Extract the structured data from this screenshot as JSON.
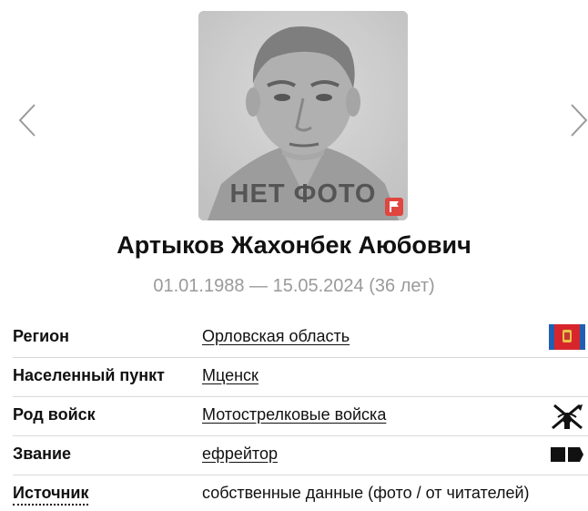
{
  "navigation": {
    "prev_icon": "chevron-left-icon",
    "next_icon": "chevron-right-icon"
  },
  "photo": {
    "caption": "НЕТ ФОТО",
    "report_icon": "flag-icon",
    "report_color": "#e0463f"
  },
  "person": {
    "name": "Артыков Жахонбек Аюбович",
    "dates": "01.01.1988 — 15.05.2024 (36 лет)"
  },
  "info": {
    "region": {
      "label": "Регион",
      "value": "Орловская область",
      "icon": "region-flag-icon"
    },
    "settlement": {
      "label": "Населенный пункт",
      "value": "Мценск"
    },
    "branch": {
      "label": "Род войск",
      "value": "Мотострелковые войска",
      "icon": "motor-rifle-emblem-icon"
    },
    "rank": {
      "label": "Звание",
      "value": "ефрейтор",
      "icon": "rank-insignia-icon"
    },
    "source": {
      "label": "Источник",
      "value": "собственные данные (фото / от читателей)"
    }
  },
  "colors": {
    "text": "#111111",
    "muted": "#9a9a9a",
    "divider": "#d9d9d9",
    "flag_red": "#d7262b",
    "flag_blue": "#1f5fb4"
  }
}
